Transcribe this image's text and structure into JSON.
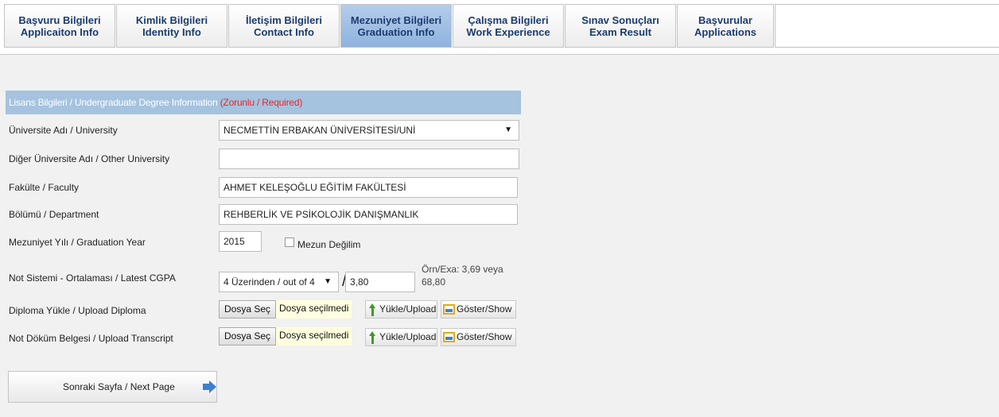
{
  "tabs": [
    {
      "line1": "Başvuru Bilgileri",
      "line2": "Applicaiton Info"
    },
    {
      "line1": "Kimlik Bilgileri",
      "line2": "Identity Info"
    },
    {
      "line1": "İletişim Bilgileri",
      "line2": "Contact Info"
    },
    {
      "line1": "Mezuniyet Bilgileri",
      "line2": "Graduation Info"
    },
    {
      "line1": "Çalışma Bilgileri",
      "line2": "Work Experience"
    },
    {
      "line1": "Sınav Sonuçları",
      "line2": "Exam Result"
    },
    {
      "line1": "Başvurular",
      "line2": "Applications"
    }
  ],
  "section": {
    "title": "Lisans Bilgileri / Undergraduate Degree Information",
    "required": "(Zorunlu / Required)"
  },
  "form": {
    "university": {
      "label": "Üniversite Adı / University",
      "value": "NECMETTİN ERBAKAN ÜNİVERSİTESİ/UNİ"
    },
    "other_university": {
      "label": "Diğer Üniversite Adı / Other University",
      "value": ""
    },
    "faculty": {
      "label": "Fakülte / Faculty",
      "value": "AHMET KELEŞOĞLU EĞİTİM FAKÜLTESİ"
    },
    "department": {
      "label": "Bölümü / Department",
      "value": "REHBERLİK VE PSİKOLOJİK DANIŞMANLIK"
    },
    "graduation_year": {
      "label": "Mezuniyet Yılı / Graduation Year",
      "value": "2015",
      "not_graduated_label": "Mezun Değilim"
    },
    "cgpa": {
      "label": "Not Sistemi - Ortalaması / Latest CGPA",
      "system": "4 Üzerinden / out of 4",
      "separator": "/",
      "value": "3,80",
      "hint_line1": "Örn/Exa: 3,69 veya",
      "hint_line2": "68,80"
    },
    "diploma": {
      "label": "Diploma Yükle / Upload Diploma",
      "choose": "Dosya Seç",
      "no_file": "Dosya seçilmedi",
      "upload": "Yükle/Upload",
      "show": "Göster/Show"
    },
    "transcript": {
      "label": "Not Döküm Belgesi / Upload Transcript",
      "choose": "Dosya Seç",
      "no_file": "Dosya seçilmedi",
      "upload": "Yükle/Upload",
      "show": "Göster/Show"
    }
  },
  "next_button": {
    "label": "Sonraki Sayfa / Next Page"
  },
  "icons": {
    "upload": "upload-arrow-icon",
    "show": "image-icon",
    "next": "right-arrow-icon",
    "dropdown": "dropdown-arrow-icon"
  },
  "colors": {
    "active_tab": "#9dbde5",
    "section_header": "#a5c3df",
    "required": "#e8262a",
    "tab_text": "#1b3c6e"
  }
}
